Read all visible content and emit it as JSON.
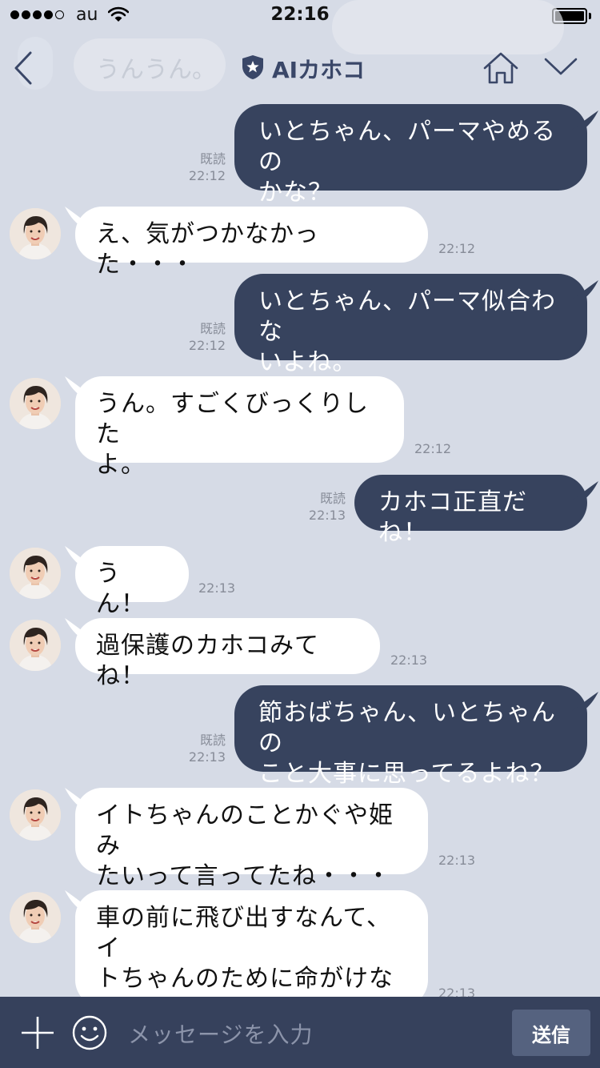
{
  "status_bar": {
    "carrier": "au",
    "time": "22:16"
  },
  "header": {
    "title": "AIカホコ",
    "ghost_text": "うんうん。"
  },
  "messages": [
    {
      "side": "out",
      "text": "いとちゃん、パーマやめるの\nかな？",
      "read": "既読",
      "time": "22:12"
    },
    {
      "side": "in",
      "text": "え、気がつかなかった・・・",
      "time": "22:12"
    },
    {
      "side": "out",
      "text": "いとちゃん、パーマ似合わな\nいよね。",
      "read": "既読",
      "time": "22:12"
    },
    {
      "side": "in",
      "text": "うん。すごくびっくりした\nよ。",
      "time": "22:12"
    },
    {
      "side": "out",
      "text": "カホコ正直だね！",
      "read": "既読",
      "time": "22:13"
    },
    {
      "side": "in",
      "text": "うん！",
      "time": "22:13"
    },
    {
      "side": "in",
      "text": "過保護のカホコみてね！",
      "time": "22:13"
    },
    {
      "side": "out",
      "text": "節おばちゃん、いとちゃんの\nこと大事に思ってるよね？",
      "read": "既読",
      "time": "22:13"
    },
    {
      "side": "in",
      "text": "イトちゃんのことかぐや姫み\nたいって言ってたね・・・",
      "time": "22:13"
    },
    {
      "side": "in",
      "text": "車の前に飛び出すなんて、イ\nトちゃんのために命がけなん\nだよ！",
      "time": "22:13"
    }
  ],
  "input_bar": {
    "placeholder": "メッセージを入力",
    "send_label": "送信"
  },
  "colors": {
    "background": "#d6dbe6",
    "outgoing_bubble": "#37435e",
    "incoming_bubble": "#ffffff",
    "accent": "#3a4768"
  }
}
